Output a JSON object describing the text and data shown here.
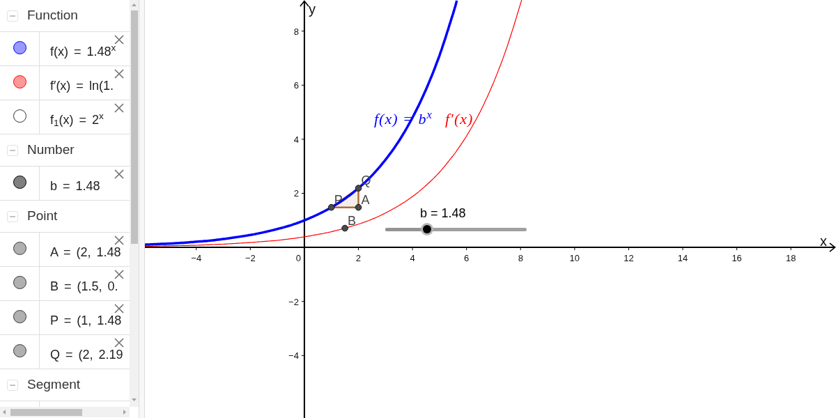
{
  "algebra_view": {
    "groups": [
      {
        "heading": "Function",
        "expanded": true,
        "items": [
          {
            "text": "f(x) = 1.48$^{x}$",
            "color": "#9999ff",
            "shown": true
          },
          {
            "text": "f′(x) = ln(1.",
            "color": "#ff9999",
            "shown": true
          },
          {
            "text": "f$_{1}$(x) = 2$^{x}$",
            "shown": false
          }
        ]
      },
      {
        "heading": "Number",
        "expanded": true,
        "items": [
          {
            "text": "b = 1.48",
            "color": "#808080",
            "shown": true
          }
        ]
      },
      {
        "heading": "Point",
        "expanded": true,
        "items": [
          {
            "text": "A = (2, 1.48",
            "color": "#b0b0b0",
            "shown": true
          },
          {
            "text": "B = (1.5, 0.",
            "color": "#b0b0b0",
            "shown": true
          },
          {
            "text": "P = (1, 1.48",
            "color": "#b0b0b0",
            "shown": true
          },
          {
            "text": "Q = (2, 2.19",
            "color": "#b0b0b0",
            "shown": true
          }
        ]
      },
      {
        "heading": "Segment",
        "expanded": true
      }
    ]
  },
  "graphics_view": {
    "chart_data": {
      "type": "line",
      "xlabel": "x",
      "ylabel": "y",
      "x": [
        -5.9,
        -5.5,
        -5,
        -4.5,
        -4,
        -3.5,
        -3,
        -2.5,
        -2,
        -1.5,
        -1,
        -0.5,
        0,
        0.5,
        1,
        1.5,
        2,
        2.5,
        3,
        3.5,
        4,
        4.5,
        5,
        5.5,
        5.64,
        6,
        6.5,
        7,
        7.5,
        8,
        8.03
      ],
      "series": [
        {
          "name": "f(x) = b$^{x}$",
          "color": "#0000ff",
          "values": [
            0.1,
            0.12,
            0.14,
            0.17,
            0.21,
            0.25,
            0.31,
            0.38,
            0.46,
            0.56,
            0.68,
            0.82,
            1,
            1.22,
            1.48,
            1.8,
            2.19,
            2.66,
            3.24,
            3.94,
            4.8,
            5.84,
            7.1,
            8.64,
            9.13,
            null,
            null,
            null,
            null,
            null,
            null
          ]
        },
        {
          "name": "f′(x)",
          "color": "#ff0000",
          "values": [
            0.04,
            0.05,
            0.06,
            0.07,
            0.08,
            0.1,
            0.12,
            0.15,
            0.18,
            0.22,
            0.26,
            0.32,
            0.39,
            0.48,
            0.58,
            0.71,
            0.86,
            1.04,
            1.27,
            1.55,
            1.88,
            2.29,
            2.78,
            3.39,
            3.58,
            4.12,
            5.01,
            6.1,
            7.42,
            9.02,
            9.13
          ]
        }
      ],
      "xlim": [
        -5.9,
        19.67
      ],
      "ylim": [
        -6.31,
        9.15
      ],
      "xticks": [
        {
          "value": -4,
          "label": "−4"
        },
        {
          "value": -2,
          "label": "−2"
        },
        2,
        4,
        6,
        8,
        10,
        12,
        14,
        16,
        18
      ],
      "yticks": [
        {
          "value": -4,
          "label": "−4"
        },
        {
          "value": -2,
          "label": "−2"
        },
        2,
        4,
        6,
        8
      ],
      "annotations": [
        {
          "text": "A",
          "x": 2,
          "y": 1.48
        },
        {
          "text": "B",
          "x": 1.5,
          "y": 0.71
        },
        {
          "text": "P",
          "x": 1,
          "y": 1.48
        },
        {
          "text": "Q",
          "x": 2,
          "y": 2.19
        }
      ]
    },
    "origin_label": "0",
    "slider": {
      "label": "b = 1.48",
      "level": 0.296
    }
  }
}
